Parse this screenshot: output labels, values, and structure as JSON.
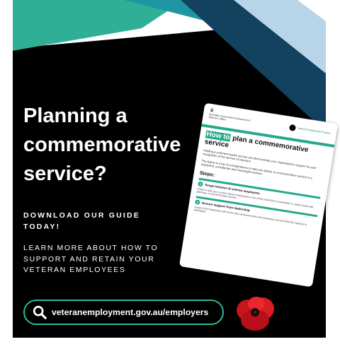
{
  "headline": "Planning a commemorative service?",
  "cta": "DOWNLOAD OUR GUIDE TODAY!",
  "learn_more": "LEARN MORE ABOUT HOW TO SUPPORT AND RETAIN YOUR VETERAN EMPLOYEES",
  "url": "veteranemployment.gov.au/employers",
  "colors": {
    "teal": "#2cb89b",
    "background": "#000000",
    "text": "#ffffff"
  },
  "icons": {
    "url": "search-icon",
    "poppy": "poppy-icon"
  },
  "document": {
    "gov_label": "Australian Government Department of Veterans' Affairs",
    "program_label": "Veteran Employment Program",
    "title_highlight": "How to",
    "title_rest": " plan a commemorative service",
    "intro": "Holding a commemorative service can demonstrate your organisation's support for and recognition of the service of veterans.",
    "intro2": "The below is a list of considerations to help you deliver a commemorative service in a respectful, considerate and meaningful manner.",
    "steps_label": "Steps:",
    "step1_title": "Scope interest of veteran employees",
    "step1_text": "Check in with your current veteran employees to see if they would like to participate in, and/or assist with planning, a commemorative service.",
    "step2_title": "Ensure support from leadership",
    "step2_text": "Support from leadership will ensure that commemoration and employees are provided the capacity to participate."
  }
}
